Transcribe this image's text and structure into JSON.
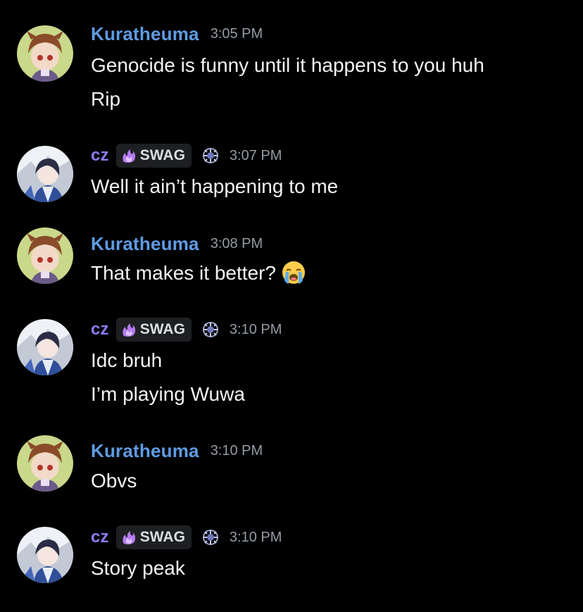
{
  "messages": [
    {
      "author": "Kuratheuma",
      "time": "3:05 PM",
      "lines": [
        "Genocide is funny until it happens to you huh",
        "Rip"
      ]
    },
    {
      "author": "cz",
      "tag": "SWAG",
      "tag_icon": "purple-flame-icon",
      "badge_icon": "guild-crest-icon",
      "time": "3:07 PM",
      "lines": [
        "Well it ain’t happening to me"
      ]
    },
    {
      "author": "Kuratheuma",
      "time": "3:08 PM",
      "lines": [
        "That makes it better?"
      ],
      "emoji": "loudly-crying-face-emoji"
    },
    {
      "author": "cz",
      "tag": "SWAG",
      "tag_icon": "purple-flame-icon",
      "badge_icon": "guild-crest-icon",
      "time": "3:10 PM",
      "lines": [
        "Idc bruh",
        "I’m playing Wuwa"
      ]
    },
    {
      "author": "Kuratheuma",
      "time": "3:10 PM",
      "lines": [
        "Obvs"
      ]
    },
    {
      "author": "cz",
      "tag": "SWAG",
      "tag_icon": "purple-flame-icon",
      "badge_icon": "guild-crest-icon",
      "time": "3:10 PM",
      "lines": [
        "Story peak"
      ]
    }
  ],
  "colors": {
    "background": "#000000",
    "kuratheuma_name": "#5f9be3",
    "cz_name": "#8a7cf0",
    "timestamp": "#949ba4",
    "message_text": "#f2f3f5",
    "tag_background": "#1e1f22"
  }
}
